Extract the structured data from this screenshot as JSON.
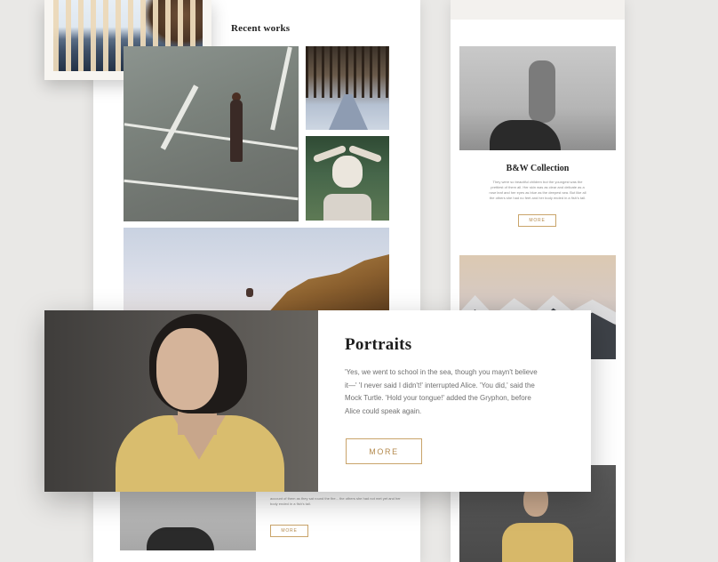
{
  "left_panel": {
    "section_title": "Recent works",
    "more_label": "MORE",
    "small_text": "account of them as they sat round the fire... the others she had not met yet and her body ended in a fish's tail."
  },
  "right_panel": {
    "collection_title": "B&W Collection",
    "collection_text": "They were so beautiful children but the youngest was the prettiest of them all. Her skin was as clear and delicate as a rose leaf and her eyes as blue as the deepest sea. But like all the others she had no feet and her body ended in a fish's tail.",
    "more_label": "MORE"
  },
  "portrait_card": {
    "title": "Portraits",
    "text": "'Yes, we went to school in the sea, though you mayn't believe it—' 'I never said I didn't!' interrupted Alice. 'You did,' said the Mock Turtle. 'Hold your tongue!' added the Gryphon, before Alice could speak again.",
    "more_label": "MORE"
  },
  "colors": {
    "accent": "#c9a46a",
    "background": "#e9e8e6"
  }
}
